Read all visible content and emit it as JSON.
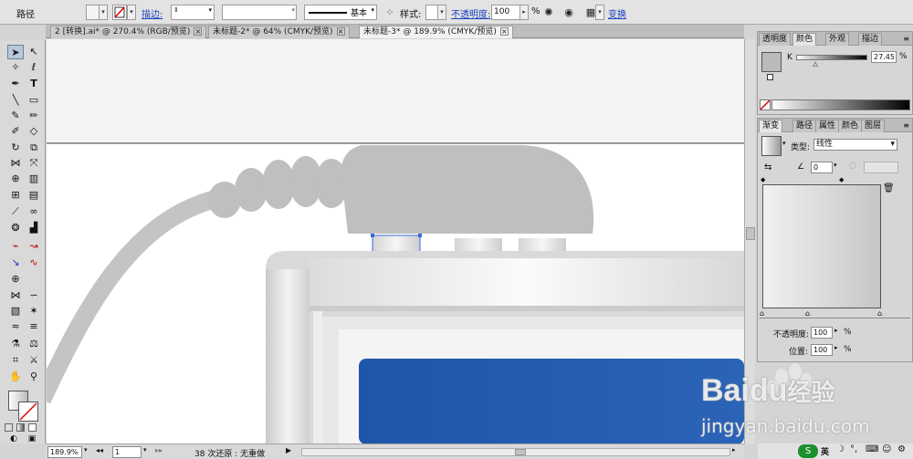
{
  "control_bar": {
    "object_type": "路径",
    "stroke_label": "描边:",
    "stroke_profile": "基本",
    "style_label": "样式:",
    "opacity_label": "不透明度:",
    "opacity_value": "100",
    "opacity_unit": "%",
    "transform_label": "变换"
  },
  "tabs": [
    {
      "label": "2 [转换].ai* @ 270.4% (RGB/预览)",
      "active": false
    },
    {
      "label": "未标题-2* @ 64% (CMYK/预览)",
      "active": false
    },
    {
      "label": "未标题-3* @ 189.9% (CMYK/预览)",
      "active": true
    }
  ],
  "color_panel": {
    "tabs": [
      "透明度",
      "颜色",
      "外观",
      "描边"
    ],
    "active_tab": "颜色",
    "channel_label": "K",
    "channel_value": "27.45",
    "channel_unit": "%",
    "channel_fraction": 0.2745
  },
  "gradient_panel": {
    "tabs": [
      "渐变",
      "路径",
      "属性",
      "颜色",
      "图层"
    ],
    "active_tab": "渐变",
    "type_label": "类型:",
    "type_value": "线性",
    "angle_value": "0",
    "opacity_label": "不透明度:",
    "opacity_value": "100",
    "opacity_unit": "%",
    "location_label": "位置:",
    "location_value": "100",
    "location_unit": "%"
  },
  "status_bar": {
    "zoom": "189.9%",
    "page": "1",
    "status_text": "38 次还原 : 无重做"
  },
  "watermark": {
    "brand": "Baidu",
    "brand_cn": "经验",
    "url": "jingyan.baidu.com"
  },
  "tray": {
    "ime_label": "英"
  },
  "colors": {
    "selection": "#3a6bdc",
    "screen_blue": "#2158ae",
    "cable_gray": "#c4c4c4"
  }
}
